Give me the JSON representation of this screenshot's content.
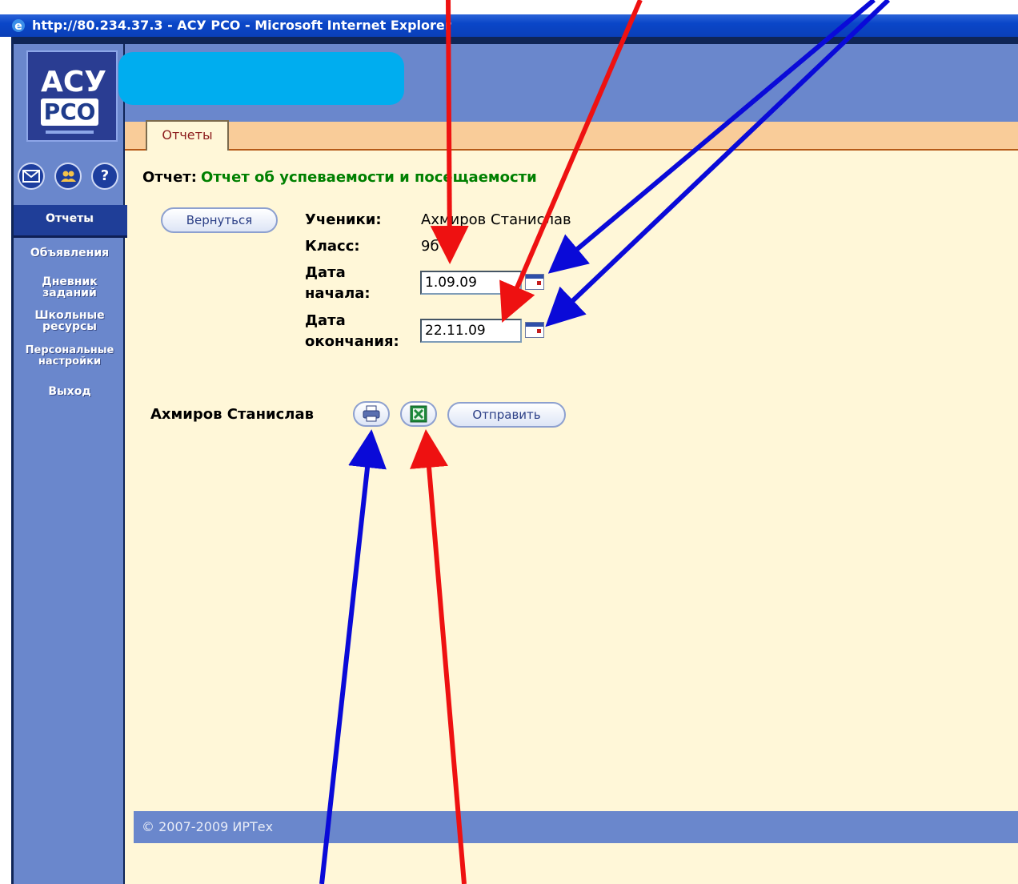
{
  "window": {
    "title": "http://80.234.37.3 - АСУ РСО - Microsoft Internet Explorer"
  },
  "logo": {
    "line1": "АСУ",
    "line2": "РСО"
  },
  "tabs": [
    {
      "label": "Отчеты"
    }
  ],
  "sidebar": {
    "icons": [
      "mail-icon",
      "users-icon",
      "help-icon"
    ],
    "items": [
      {
        "label": "Отчеты"
      },
      {
        "label": "Объявления"
      },
      {
        "label": "Дневник заданий"
      },
      {
        "label": "Школьные ресурсы"
      },
      {
        "label": "Персональные настройки"
      },
      {
        "label": "Выход"
      }
    ]
  },
  "report": {
    "heading_label": "Отчет:",
    "heading_value": "Отчет об успеваемости и посещаемости",
    "back_button": "Вернуться",
    "students_label": "Ученики:",
    "students_value": "Ахмиров Станислав",
    "class_label": "Класс:",
    "class_value": "9б",
    "start_label_1": "Дата",
    "start_label_2": "начала:",
    "start_date": "1.09.09",
    "end_label_1": "Дата",
    "end_label_2": "окончания:",
    "end_date": "22.11.09",
    "student_name": "Ахмиров Станислав",
    "send_button": "Отправить"
  },
  "footer": {
    "copyright": "© 2007-2009 ИРТех"
  },
  "colors": {
    "sidebar": "#6a87cc",
    "content_bg": "#fff7d8",
    "tab_strip": "#f9cc99",
    "heading_value": "#008000",
    "arrow_red": "#ee1111",
    "arrow_blue": "#0a0ad8",
    "blur_patch": "#00adef"
  }
}
